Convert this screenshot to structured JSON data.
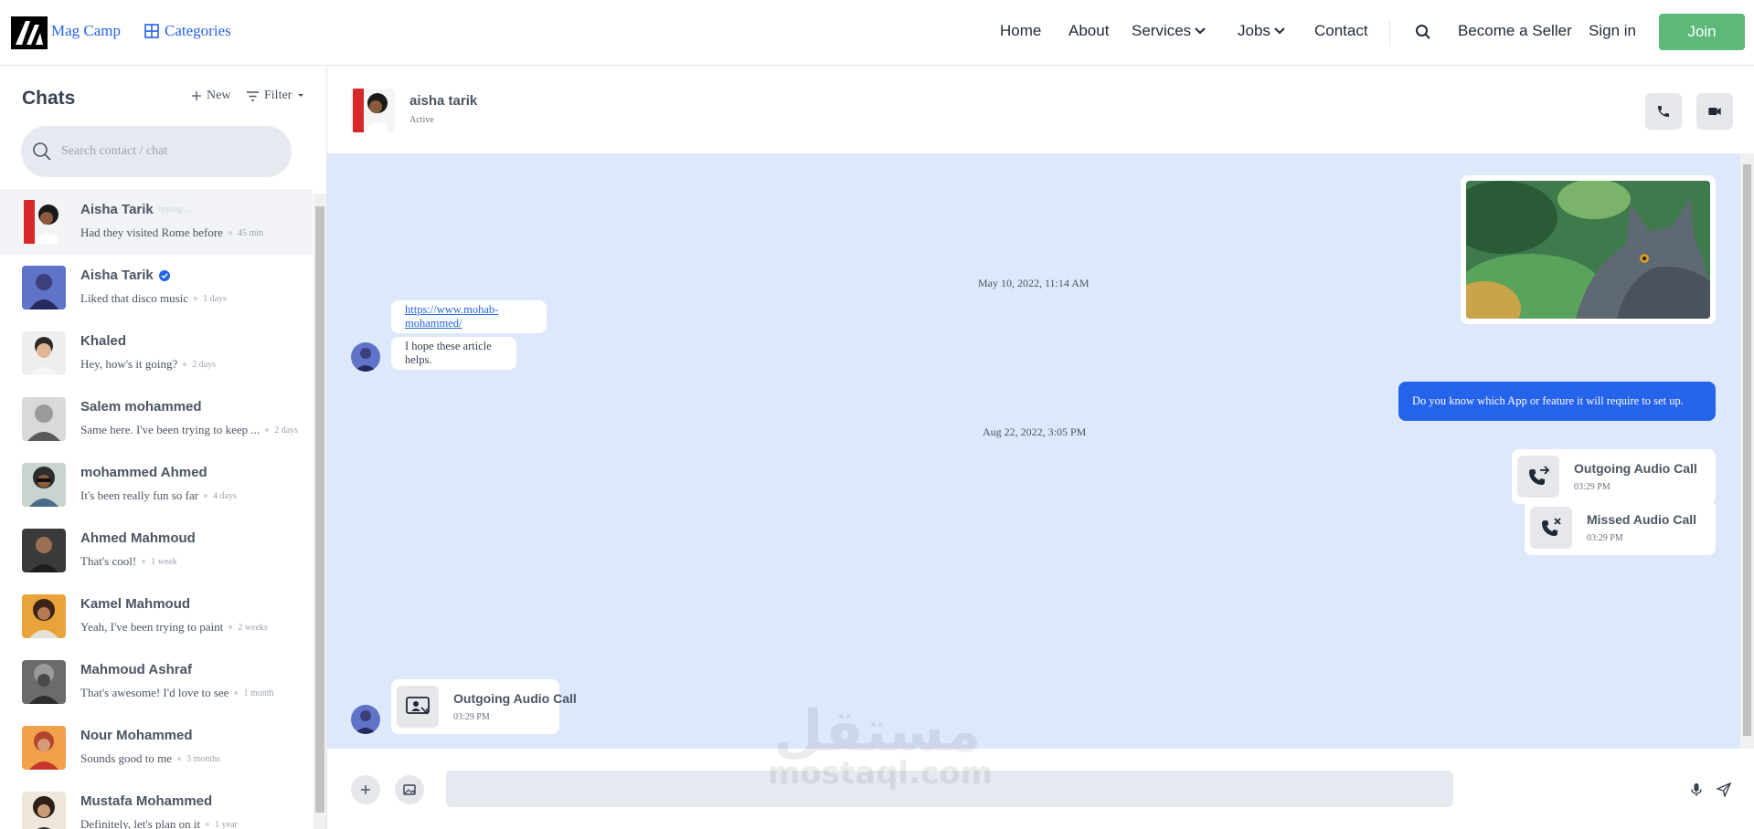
{
  "header": {
    "brand": "Mag Camp",
    "categories": "Categories",
    "nav": [
      "Home",
      "About",
      "Services",
      "Jobs",
      "Contact"
    ],
    "become_seller": "Become a Seller",
    "sign_in": "Sign in",
    "join": "Join"
  },
  "sidebar": {
    "title": "Chats",
    "new_label": "New",
    "filter_label": "Filter",
    "search_placeholder": "Search contact / chat",
    "contacts": [
      {
        "name": "Aisha Tarik",
        "status": "typing ...",
        "message": "Had they visited Rome before",
        "time": "45 min"
      },
      {
        "name": "Aisha Tarik",
        "verified": true,
        "message": "Liked that disco music",
        "time": "1 days"
      },
      {
        "name": "Khaled",
        "message": "Hey, how's it going?",
        "time": "2 days"
      },
      {
        "name": "Salem mohammed",
        "message": "Same here. I've been trying to keep ...",
        "time": "2 days"
      },
      {
        "name": "mohammed Ahmed",
        "message": "It's been really fun so far",
        "time": "4 days"
      },
      {
        "name": "Ahmed Mahmoud",
        "message": "That's cool!",
        "time": "1 week"
      },
      {
        "name": "Kamel Mahmoud",
        "message": "Yeah, I've been trying to paint",
        "time": "2 weeks"
      },
      {
        "name": "Mahmoud Ashraf",
        "message": "That's awesome! I'd love to see",
        "time": "1 month"
      },
      {
        "name": "Nour Mohammed",
        "message": "Sounds good to me",
        "time": "3 months"
      },
      {
        "name": "Mustafa Mohammed",
        "message": "Definitely, let's plan on it",
        "time": "1 year"
      }
    ]
  },
  "chat": {
    "name": "aisha tarik",
    "status": "Active",
    "date1": "May 10, 2022, 11:14 AM",
    "link": "https://www.mohab-mohammed/",
    "incoming_text": "I hope these article helps.",
    "outgoing_text": "Do you know which App or feature it will require to set up.",
    "date2": "Aug 22, 2022, 3:05 PM",
    "calls": [
      {
        "title": "Outgoing Audio Call",
        "time": "03:29 PM"
      },
      {
        "title": "Missed Audio Call",
        "time": "03:29 PM"
      },
      {
        "title": "Outgoing Audio Call",
        "time": "03:29 PM"
      }
    ]
  },
  "composer": {
    "placeholder": ""
  },
  "watermark": {
    "arabic": "مستقل",
    "latin": "mostaql.com"
  }
}
